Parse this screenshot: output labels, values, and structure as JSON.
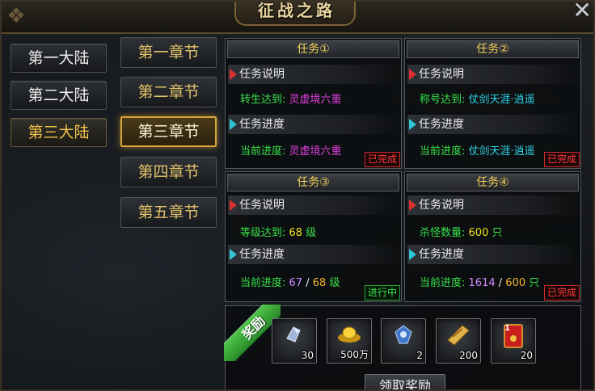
{
  "window": {
    "title": "征战之路",
    "close_symbol": "✕"
  },
  "continents": [
    {
      "label": "第一大陆",
      "active": false
    },
    {
      "label": "第二大陆",
      "active": false
    },
    {
      "label": "第三大陆",
      "active": true
    }
  ],
  "chapters": [
    {
      "label": "第一章节",
      "active": false
    },
    {
      "label": "第二章节",
      "active": false
    },
    {
      "label": "第三章节",
      "active": true
    },
    {
      "label": "第四章节",
      "active": false
    },
    {
      "label": "第五章节",
      "active": false
    }
  ],
  "section_labels": {
    "description": "任务说明",
    "progress": "任务进度"
  },
  "tasks": [
    {
      "title": "任务①",
      "req_label": "转生达到:",
      "req_value": "灵虚境六重",
      "progress_label": "当前进度:",
      "progress_value": "灵虚境六重",
      "status": "已完成"
    },
    {
      "title": "任务②",
      "req_label": "称号达到:",
      "req_value": "仗剑天涯·逍遥",
      "progress_label": "当前进度:",
      "progress_value": "仗剑天涯·逍遥",
      "status": "已完成"
    },
    {
      "title": "任务③",
      "req_label": "等级达到:",
      "req_value": "68",
      "req_unit": "级",
      "progress_label": "当前进度:",
      "progress_current": "67",
      "progress_sep": "/",
      "progress_target": "68",
      "progress_unit": "级",
      "status": "进行中"
    },
    {
      "title": "任务④",
      "req_label": "杀怪数量:",
      "req_value": "600",
      "req_unit": "只",
      "progress_label": "当前进度:",
      "progress_current": "1614",
      "progress_sep": "/",
      "progress_target": "600",
      "progress_unit": "只",
      "status": "已完成"
    }
  ],
  "rewards": {
    "ribbon_label": "奖励",
    "items": [
      {
        "icon": "crystal-shard-icon",
        "count": "30"
      },
      {
        "icon": "gold-ingot-icon",
        "count": "500万"
      },
      {
        "icon": "blue-gem-icon",
        "count": "2"
      },
      {
        "icon": "scroll-ticket-icon",
        "count": "200"
      },
      {
        "icon": "red-envelope-icon",
        "count": "20",
        "badge": "1"
      }
    ],
    "claim_label": "领取奖励"
  },
  "colors": {
    "gold_text": "#f2cf5a",
    "done_red": "#ff3a3a",
    "progress_green": "#3ce04a"
  }
}
